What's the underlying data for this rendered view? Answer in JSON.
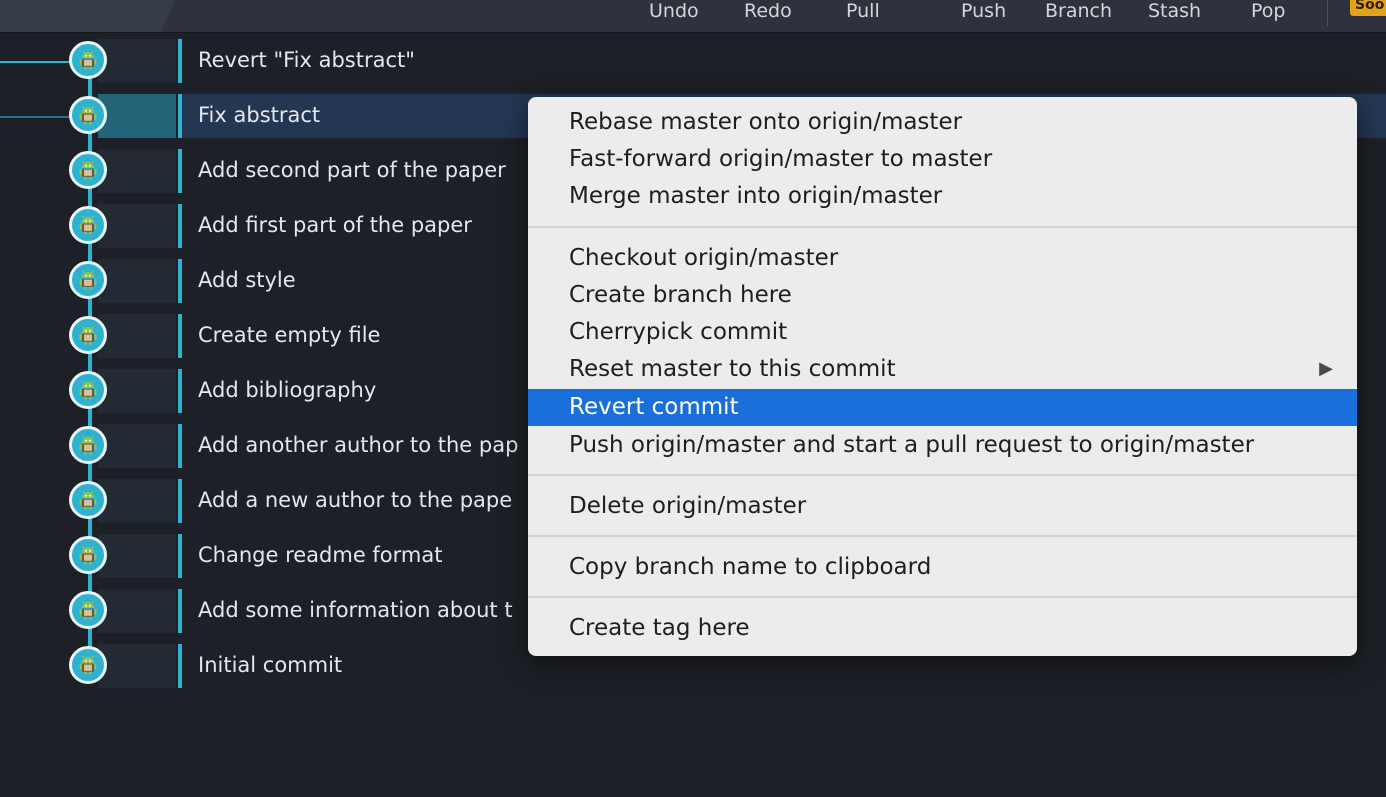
{
  "toolbar": {
    "buttons": [
      "Undo",
      "Redo",
      "Pull",
      "Push",
      "Branch",
      "Stash",
      "Pop"
    ],
    "badge": "Soo"
  },
  "commits": [
    {
      "message": "Revert \"Fix abstract\""
    },
    {
      "message": "Fix abstract",
      "selected": true
    },
    {
      "message": "Add second part of the paper"
    },
    {
      "message": "Add first part of the paper"
    },
    {
      "message": "Add style"
    },
    {
      "message": "Create empty file"
    },
    {
      "message": "Add bibliography"
    },
    {
      "message": "Add another author to the pap"
    },
    {
      "message": "Add a new author to the pape"
    },
    {
      "message": "Change readme format"
    },
    {
      "message": "Add some information about t"
    },
    {
      "message": "Initial commit"
    }
  ],
  "context_menu": {
    "items": [
      "Rebase master onto origin/master",
      "Fast-forward origin/master to master",
      "Merge master into origin/master",
      "Checkout origin/master",
      "Create branch here",
      "Cherrypick commit",
      "Reset master to this commit",
      "Revert commit",
      "Push origin/master and start a pull request to origin/master",
      "Delete origin/master",
      "Copy branch name to clipboard",
      "Create tag here"
    ],
    "active_item": "Revert commit",
    "submenu_arrow": "▶"
  },
  "icons": {
    "commit_avatar": "android-icon",
    "submenu": "chevron-right-icon"
  },
  "colors": {
    "graph": "#2fb1d0",
    "selection": "#233753",
    "menu_highlight": "#1a6fdb",
    "badge": "#e3a218"
  }
}
